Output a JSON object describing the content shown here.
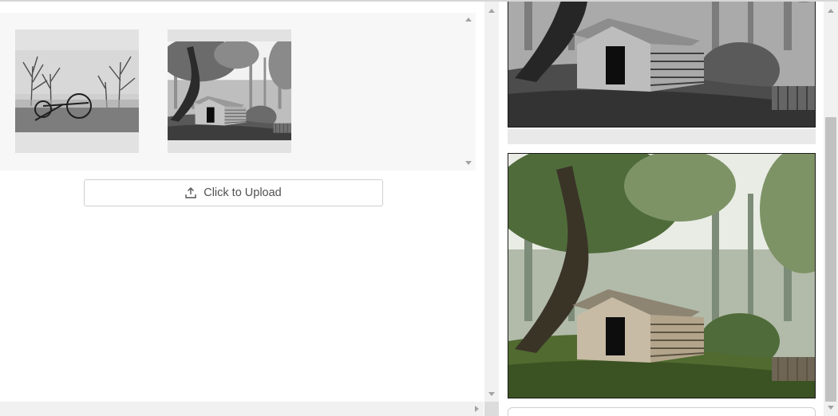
{
  "upload": {
    "label": "Click to Upload",
    "icon": "upload-icon"
  },
  "gallery": {
    "items": [
      {
        "name": "foggy-field-hay-rake-photo"
      },
      {
        "name": "grayscale-log-cabin-photo"
      }
    ]
  },
  "viewer": {
    "images": [
      {
        "name": "grayscale-log-cabin-photo-large"
      },
      {
        "name": "color-log-cabin-photo-large"
      }
    ]
  },
  "colors": {
    "gallery_background": "#f7f7f7",
    "thumbnail_placeholder": "#e2e2e2",
    "button_border": "#cfcfcf",
    "button_text": "#505050",
    "scrollbar_track": "#f1f1f1",
    "scrollbar_thumb": "#c1c1c1"
  }
}
